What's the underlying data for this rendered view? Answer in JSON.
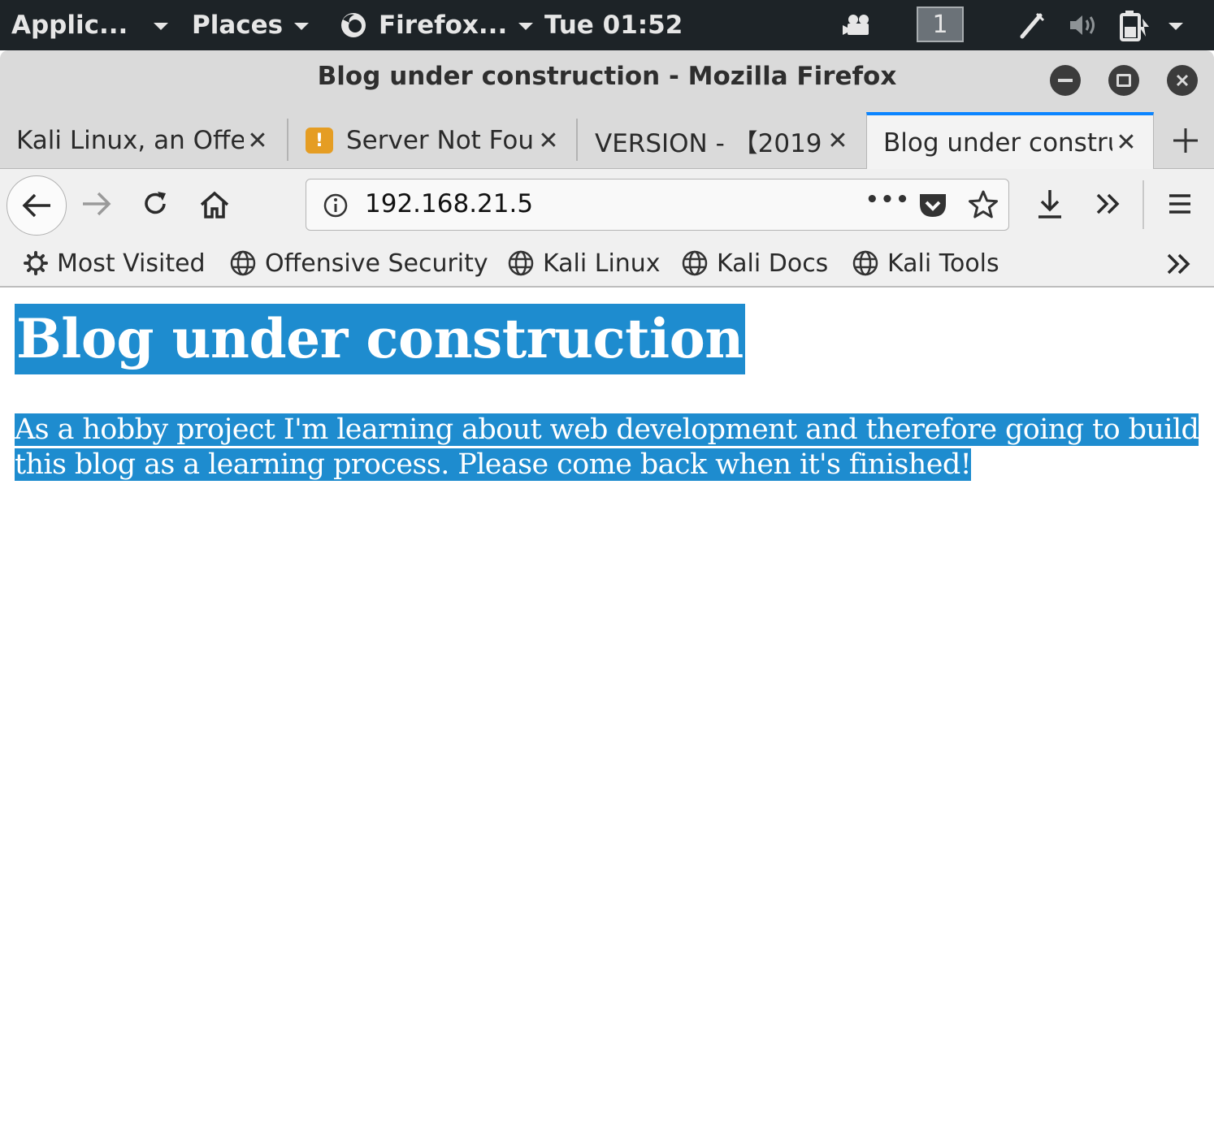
{
  "panel": {
    "applications": "Applic...",
    "places": "Places",
    "firefox": "Firefox...",
    "clock": "Tue 01:52",
    "workspace": "1"
  },
  "window": {
    "title": "Blog under construction - Mozilla Firefox"
  },
  "tabs": [
    {
      "label": "Kali Linux, an Offensive Security"
    },
    {
      "label": "Server Not Found"
    },
    {
      "label": "VERSION - 【2019"
    },
    {
      "label": "Blog under construction"
    }
  ],
  "navbar": {
    "url": "192.168.21.5",
    "page_actions": "•••"
  },
  "bookmarks": [
    {
      "label": "Most Visited",
      "icon": "gear-icon"
    },
    {
      "label": "Offensive Security",
      "icon": "globe-icon"
    },
    {
      "label": "Kali Linux",
      "icon": "globe-icon"
    },
    {
      "label": "Kali Docs",
      "icon": "globe-icon"
    },
    {
      "label": "Kali Tools",
      "icon": "globe-icon"
    }
  ],
  "page": {
    "heading": "Blog under construction",
    "paragraph": "As a hobby project I'm learning about web development and therefore going to build this blog as a learning process. Please come back when it's finished!"
  },
  "colors": {
    "selection": "#1e8ccf",
    "active_tab_accent": "#0a84ff",
    "panel_bg": "#1d2327"
  }
}
